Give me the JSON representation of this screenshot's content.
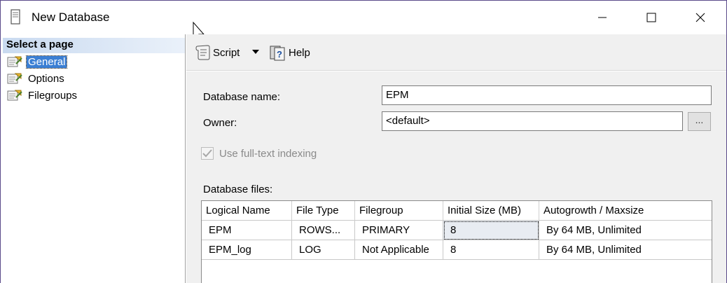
{
  "window": {
    "title": "New Database",
    "accent": "#5a4a8a"
  },
  "left_pane": {
    "header": "Select a page",
    "pages": [
      {
        "label": "General",
        "selected": true
      },
      {
        "label": "Options",
        "selected": false
      },
      {
        "label": "Filegroups",
        "selected": false
      }
    ]
  },
  "toolbar": {
    "script_label": "Script",
    "help_label": "Help"
  },
  "form": {
    "db_name_label": "Database name:",
    "db_name_value": "EPM",
    "owner_label": "Owner:",
    "owner_value": "<default>",
    "browse_label": "...",
    "fulltext_label": "Use full-text indexing",
    "fulltext_checked": true,
    "files_label": "Database files:"
  },
  "files_table": {
    "columns": [
      "Logical Name",
      "File Type",
      "Filegroup",
      "Initial Size (MB)",
      "Autogrowth / Maxsize"
    ],
    "rows": [
      [
        "EPM",
        "ROWS...",
        "PRIMARY",
        "8",
        "By 64 MB, Unlimited"
      ],
      [
        "EPM_log",
        "LOG",
        "Not Applicable",
        "8",
        "By 64 MB, Unlimited"
      ]
    ]
  }
}
